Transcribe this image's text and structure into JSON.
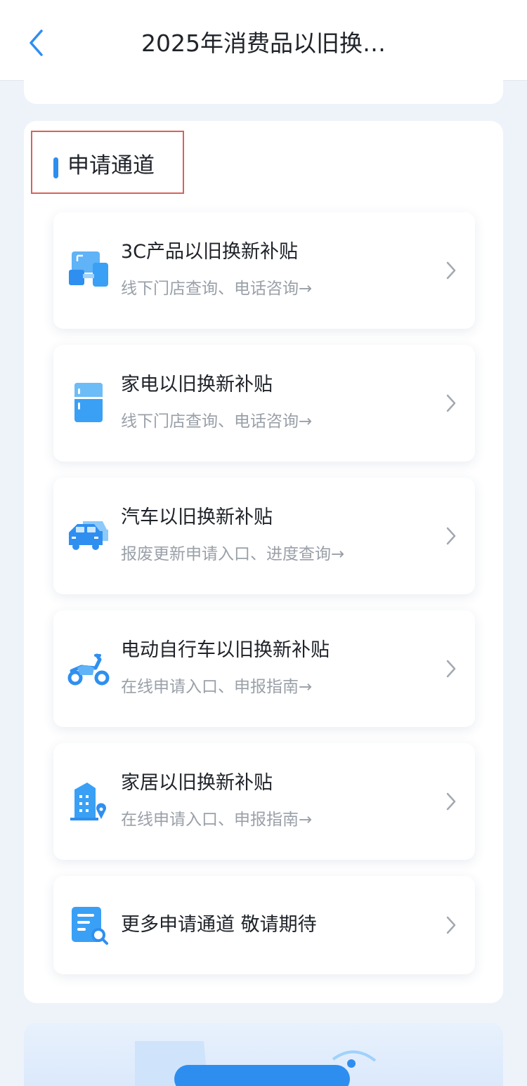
{
  "header": {
    "title": "2025年消费品以旧换…"
  },
  "section": {
    "title": "申请通道"
  },
  "items": [
    {
      "title": "3C产品以旧换新补贴",
      "subtitle": "线下门店查询、电话咨询→",
      "icon": "devices-icon"
    },
    {
      "title": "家电以旧换新补贴",
      "subtitle": "线下门店查询、电话咨询→",
      "icon": "refrigerator-icon"
    },
    {
      "title": "汽车以旧换新补贴",
      "subtitle": "报废更新申请入口、进度查询→",
      "icon": "cars-icon"
    },
    {
      "title": "电动自行车以旧换新补贴",
      "subtitle": "在线申请入口、申报指南→",
      "icon": "scooter-icon"
    },
    {
      "title": "家居以旧换新补贴",
      "subtitle": "在线申请入口、申报指南→",
      "icon": "building-location-icon"
    },
    {
      "title": "更多申请通道 敬请期待",
      "icon": "document-search-icon"
    }
  ],
  "colors": {
    "accent": "#2e8ef0",
    "highlight_border": "#d7625b",
    "subtitle": "#9aa0a8"
  }
}
